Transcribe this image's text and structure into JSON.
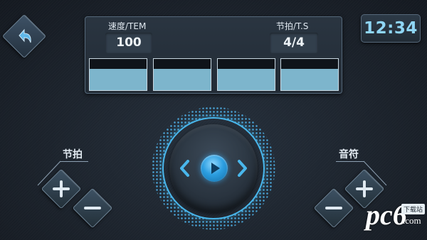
{
  "header": {
    "back_icon": "back-arrow-icon",
    "clock": "12:34"
  },
  "panel": {
    "speed_label": "速度/TEM",
    "speed_value": "100",
    "beat_label": "节拍/T.S",
    "beat_value": "4/4",
    "beat_bar_count": 4
  },
  "controls": {
    "prev_icon": "chevron-left-icon",
    "play_icon": "play-icon",
    "next_icon": "chevron-right-icon"
  },
  "beat_group": {
    "label": "节拍",
    "plus_icon": "plus-icon",
    "minus_icon": "minus-icon"
  },
  "sound_group": {
    "label": "音符",
    "plus_icon": "plus-icon",
    "minus_icon": "minus-icon"
  },
  "watermark": {
    "logo": "pc6",
    "badge": "下载站",
    "domain": ".com"
  },
  "colors": {
    "accent": "#49b7ec",
    "clock_text": "#8fd6f6",
    "bar_fill": "#7db5cc"
  }
}
